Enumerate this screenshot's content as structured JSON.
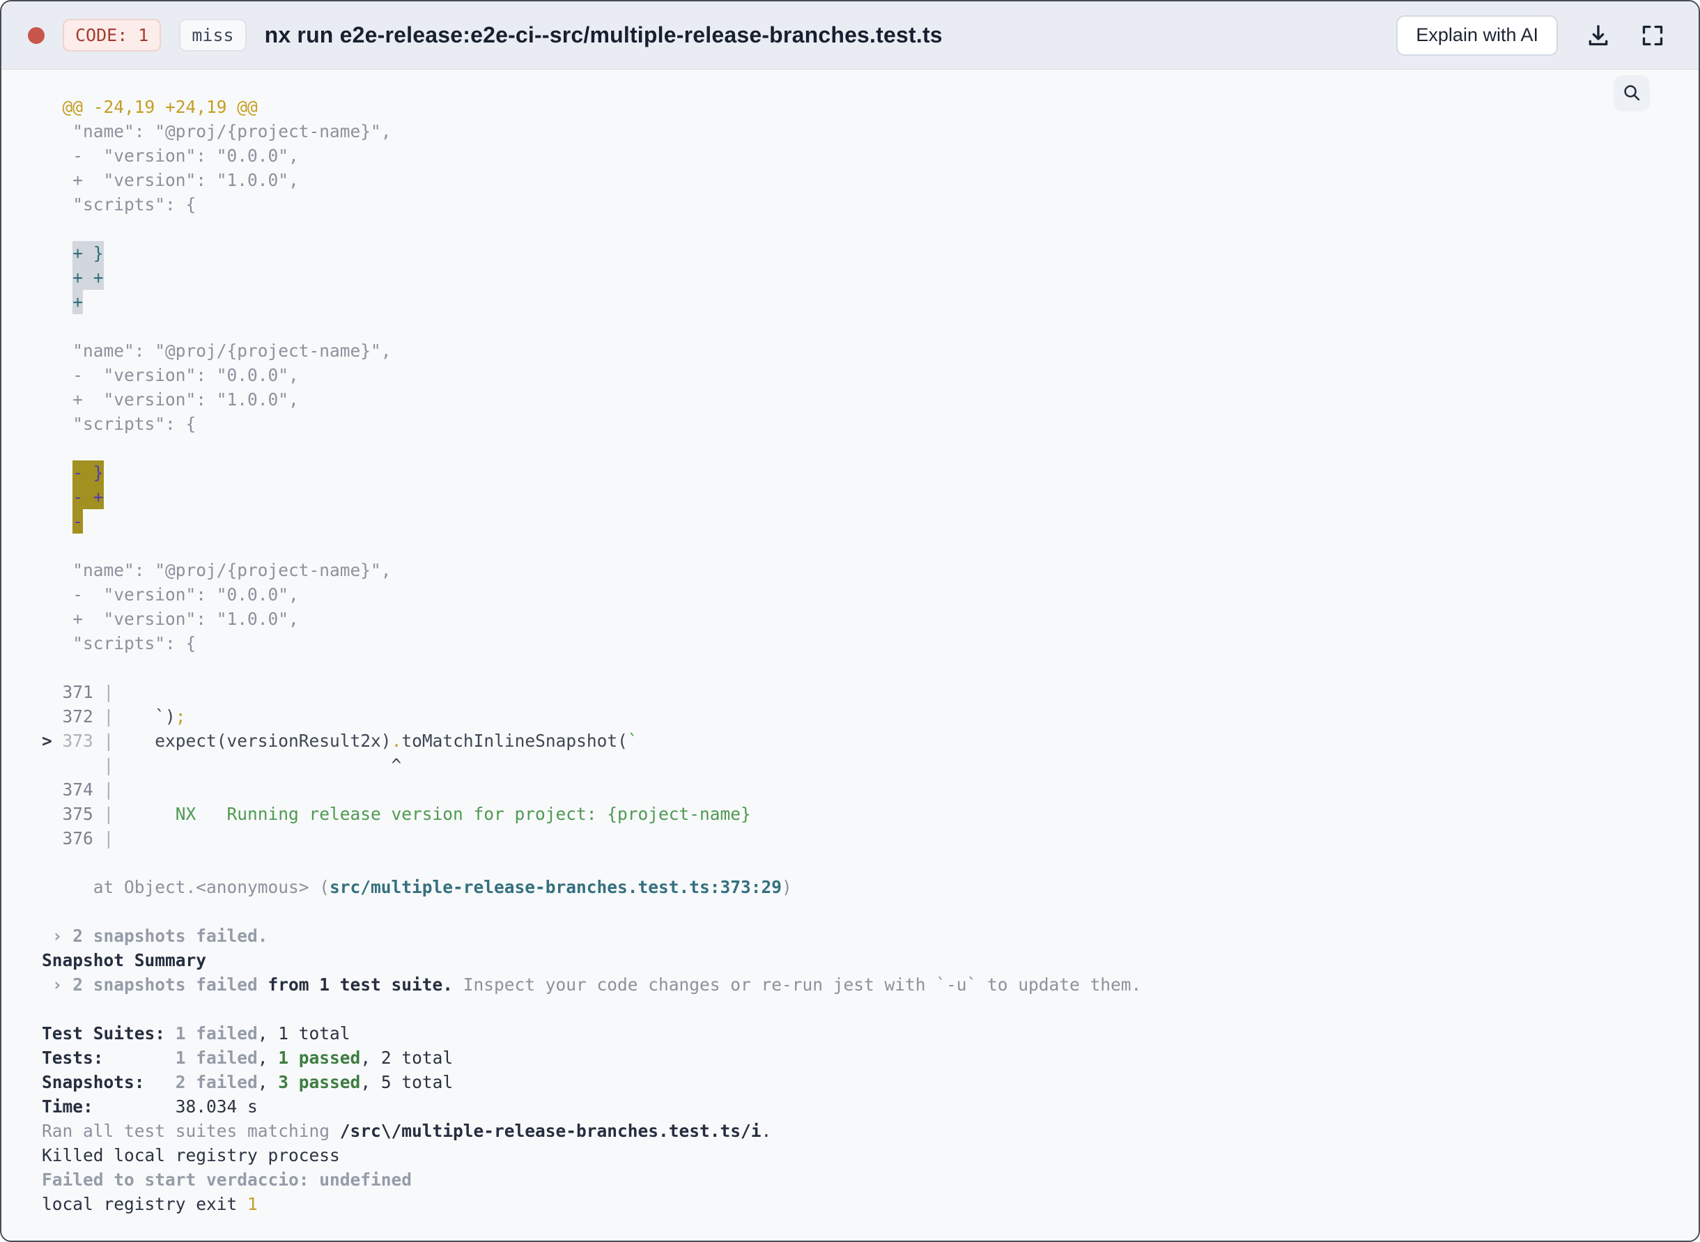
{
  "header": {
    "status_dot_color": "#c8564a",
    "code_badge": "CODE: 1",
    "cache_badge": "miss",
    "title": "nx run e2e-release:e2e-ci--src/multiple-release-branches.test.ts",
    "explain_button": "Explain with AI",
    "icons": {
      "download": "download-icon",
      "expand": "expand-icon",
      "search": "search-icon"
    }
  },
  "terminal": {
    "lines": [
      {
        "s": [
          {
            "t": "  @@ -24,19 +24,19 @@",
            "c": "y"
          }
        ]
      },
      {
        "s": [
          {
            "t": "   \"name\": \"@proj/{project-name}\",",
            "c": "d"
          }
        ]
      },
      {
        "s": [
          {
            "t": "   -  \"version\": \"0.0.0\",",
            "c": "d"
          }
        ]
      },
      {
        "s": [
          {
            "t": "   +  \"version\": \"1.0.0\",",
            "c": "d"
          }
        ]
      },
      {
        "s": [
          {
            "t": "   \"scripts\": {",
            "c": "d"
          }
        ]
      },
      {
        "s": []
      },
      {
        "s": [
          {
            "t": "   ",
            "c": "d"
          },
          {
            "t": "+ }",
            "c": "ha"
          }
        ]
      },
      {
        "s": [
          {
            "t": "   ",
            "c": "d"
          },
          {
            "t": "+ +",
            "c": "ha"
          }
        ]
      },
      {
        "s": [
          {
            "t": "   ",
            "c": "d"
          },
          {
            "t": "+",
            "c": "ha"
          }
        ]
      },
      {
        "s": []
      },
      {
        "s": [
          {
            "t": "   \"name\": \"@proj/{project-name}\",",
            "c": "d"
          }
        ]
      },
      {
        "s": [
          {
            "t": "   -  \"version\": \"0.0.0\",",
            "c": "d"
          }
        ]
      },
      {
        "s": [
          {
            "t": "   +  \"version\": \"1.0.0\",",
            "c": "d"
          }
        ]
      },
      {
        "s": [
          {
            "t": "   \"scripts\": {",
            "c": "d"
          }
        ]
      },
      {
        "s": []
      },
      {
        "s": [
          {
            "t": "   ",
            "c": "d"
          },
          {
            "t": "- }",
            "c": "hd"
          }
        ]
      },
      {
        "s": [
          {
            "t": "   ",
            "c": "d"
          },
          {
            "t": "- +",
            "c": "hd"
          }
        ]
      },
      {
        "s": [
          {
            "t": "   ",
            "c": "d"
          },
          {
            "t": "-",
            "c": "hd"
          }
        ]
      },
      {
        "s": []
      },
      {
        "s": [
          {
            "t": "   \"name\": \"@proj/{project-name}\",",
            "c": "d"
          }
        ]
      },
      {
        "s": [
          {
            "t": "   -  \"version\": \"0.0.0\",",
            "c": "d"
          }
        ]
      },
      {
        "s": [
          {
            "t": "   +  \"version\": \"1.0.0\",",
            "c": "d"
          }
        ]
      },
      {
        "s": [
          {
            "t": "   \"scripts\": {",
            "c": "d"
          }
        ]
      },
      {
        "s": []
      },
      {
        "s": [
          {
            "t": "  371 ",
            "c": "ln"
          },
          {
            "t": "|",
            "c": "pp"
          }
        ]
      },
      {
        "s": [
          {
            "t": "  372 ",
            "c": "ln"
          },
          {
            "t": "|",
            "c": "pp"
          },
          {
            "t": "    `)",
            "c": "c"
          },
          {
            "t": ";",
            "c": "y"
          }
        ]
      },
      {
        "s": [
          {
            "t": "> ",
            "c": "ab"
          },
          {
            "t": "373 ",
            "c": "lnd"
          },
          {
            "t": "|",
            "c": "pp"
          },
          {
            "t": "    expect(versionResult2x)",
            "c": "c"
          },
          {
            "t": ".",
            "c": "y"
          },
          {
            "t": "toMatchInlineSnapshot(",
            "c": "c"
          },
          {
            "t": "`",
            "c": "g"
          }
        ]
      },
      {
        "s": [
          {
            "t": "      ",
            "c": "ln"
          },
          {
            "t": "|",
            "c": "pp"
          },
          {
            "t": "                           ^",
            "c": "c"
          }
        ]
      },
      {
        "s": [
          {
            "t": "  374 ",
            "c": "ln"
          },
          {
            "t": "|",
            "c": "pp"
          }
        ]
      },
      {
        "s": [
          {
            "t": "  375 ",
            "c": "ln"
          },
          {
            "t": "|",
            "c": "pp"
          },
          {
            "t": "      NX   Running release version for project: {project-name}",
            "c": "g"
          }
        ]
      },
      {
        "s": [
          {
            "t": "  376 ",
            "c": "ln"
          },
          {
            "t": "|",
            "c": "pp"
          }
        ]
      },
      {
        "s": []
      },
      {
        "s": [
          {
            "t": "     at Object.<anonymous> (",
            "c": "d"
          },
          {
            "t": "src/multiple-release-branches.test.ts:373:29",
            "c": "tb"
          },
          {
            "t": ")",
            "c": "d"
          }
        ]
      },
      {
        "s": []
      },
      {
        "s": [
          {
            "t": " › 2 snapshots failed.",
            "c": "grb"
          }
        ]
      },
      {
        "s": [
          {
            "t": "Snapshot Summary",
            "c": "kb"
          }
        ]
      },
      {
        "s": [
          {
            "t": " › 2 snapshots failed",
            "c": "grb"
          },
          {
            "t": " from 1 test suite.",
            "c": "kb"
          },
          {
            "t": " Inspect your code changes or re-run jest with `-u` to update them.",
            "c": "d"
          }
        ]
      },
      {
        "s": []
      },
      {
        "s": [
          {
            "t": "Test Suites: ",
            "c": "kb"
          },
          {
            "t": "1 failed",
            "c": "grb"
          },
          {
            "t": ", 1 total",
            "c": "k"
          }
        ]
      },
      {
        "s": [
          {
            "t": "Tests:       ",
            "c": "kb"
          },
          {
            "t": "1 failed",
            "c": "grb"
          },
          {
            "t": ", ",
            "c": "k"
          },
          {
            "t": "1 passed",
            "c": "gb"
          },
          {
            "t": ", 2 total",
            "c": "k"
          }
        ]
      },
      {
        "s": [
          {
            "t": "Snapshots:   ",
            "c": "kb"
          },
          {
            "t": "2 failed",
            "c": "grb"
          },
          {
            "t": ", ",
            "c": "k"
          },
          {
            "t": "3 passed",
            "c": "gb"
          },
          {
            "t": ", 5 total",
            "c": "k"
          }
        ]
      },
      {
        "s": [
          {
            "t": "Time:        ",
            "c": "kb"
          },
          {
            "t": "38.034 s",
            "c": "k"
          }
        ]
      },
      {
        "s": [
          {
            "t": "Ran all test suites matching ",
            "c": "d"
          },
          {
            "t": "/src\\/multiple-release-branches.test.ts/i",
            "c": "kb"
          },
          {
            "t": ".",
            "c": "k"
          }
        ]
      },
      {
        "s": [
          {
            "t": "Killed local registry process",
            "c": "k"
          }
        ]
      },
      {
        "s": [
          {
            "t": "Failed to start verdaccio: undefined",
            "c": "grb"
          }
        ]
      },
      {
        "s": [
          {
            "t": "local registry exit ",
            "c": "k"
          },
          {
            "t": "1",
            "c": "y"
          }
        ]
      }
    ]
  }
}
